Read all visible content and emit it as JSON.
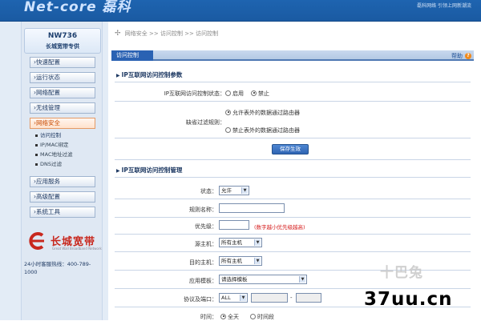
{
  "header": {
    "logo_text": "Net-core 磊科",
    "slogan": "磊科网络 引领上网新潮流"
  },
  "sidebar": {
    "model": "NW736",
    "model_sub": "长城宽带专供",
    "menu": [
      {
        "label": "快速配置",
        "active": false
      },
      {
        "label": "运行状态",
        "active": false
      },
      {
        "label": "网络配置",
        "active": false
      },
      {
        "label": "无线管理",
        "active": false
      },
      {
        "label": "网络安全",
        "active": true
      },
      {
        "label": "应用服务",
        "active": false
      },
      {
        "label": "高级配置",
        "active": false
      },
      {
        "label": "系统工具",
        "active": false
      }
    ],
    "submenu": [
      "访问控制",
      "IP/MAC绑定",
      "MAC地址过滤",
      "DNS过滤"
    ],
    "brand": "长城宽带",
    "brand_en": "Great Wall Broadband Network",
    "hotline": "24小时客服热线：400-789-1000"
  },
  "breadcrumb": [
    "网络安全",
    "访问控制",
    "访问控制"
  ],
  "panel": {
    "tab": "访问控制",
    "help": "帮助"
  },
  "section1": {
    "title": "IP互联网访问控制参数",
    "status_label": "IP互联网访问控制状态：",
    "status_options": [
      "启用",
      "禁止"
    ],
    "status_selected": "禁止",
    "rule_label": "缺省过滤规则：",
    "rule_options": [
      "允许表外的数据通过路由器",
      "禁止表外的数据通过路由器"
    ],
    "rule_selected": "允许表外的数据通过路由器",
    "save_label": "保存生效"
  },
  "section2": {
    "title": "IP互联网访问控制管理",
    "status_label": "状态：",
    "status_value": "允许",
    "rule_name_label": "规则名称：",
    "rule_name_value": "",
    "priority_label": "优先级：",
    "priority_value": "",
    "priority_hint": "(数字越小优先级越高)",
    "src_label": "源主机：",
    "src_value": "所有主机",
    "dst_label": "目的主机：",
    "dst_value": "所有主机",
    "template_label": "应用模板：",
    "template_value": "请选择模板",
    "proto_label": "协议及端口：",
    "proto_value": "ALL",
    "port_sep": "-",
    "time_label": "时间：",
    "time_options": [
      "全天",
      "时间段"
    ],
    "time_selected": "全天"
  },
  "watermark": {
    "logo": "十巴兔",
    "site": "37uu.cn"
  }
}
